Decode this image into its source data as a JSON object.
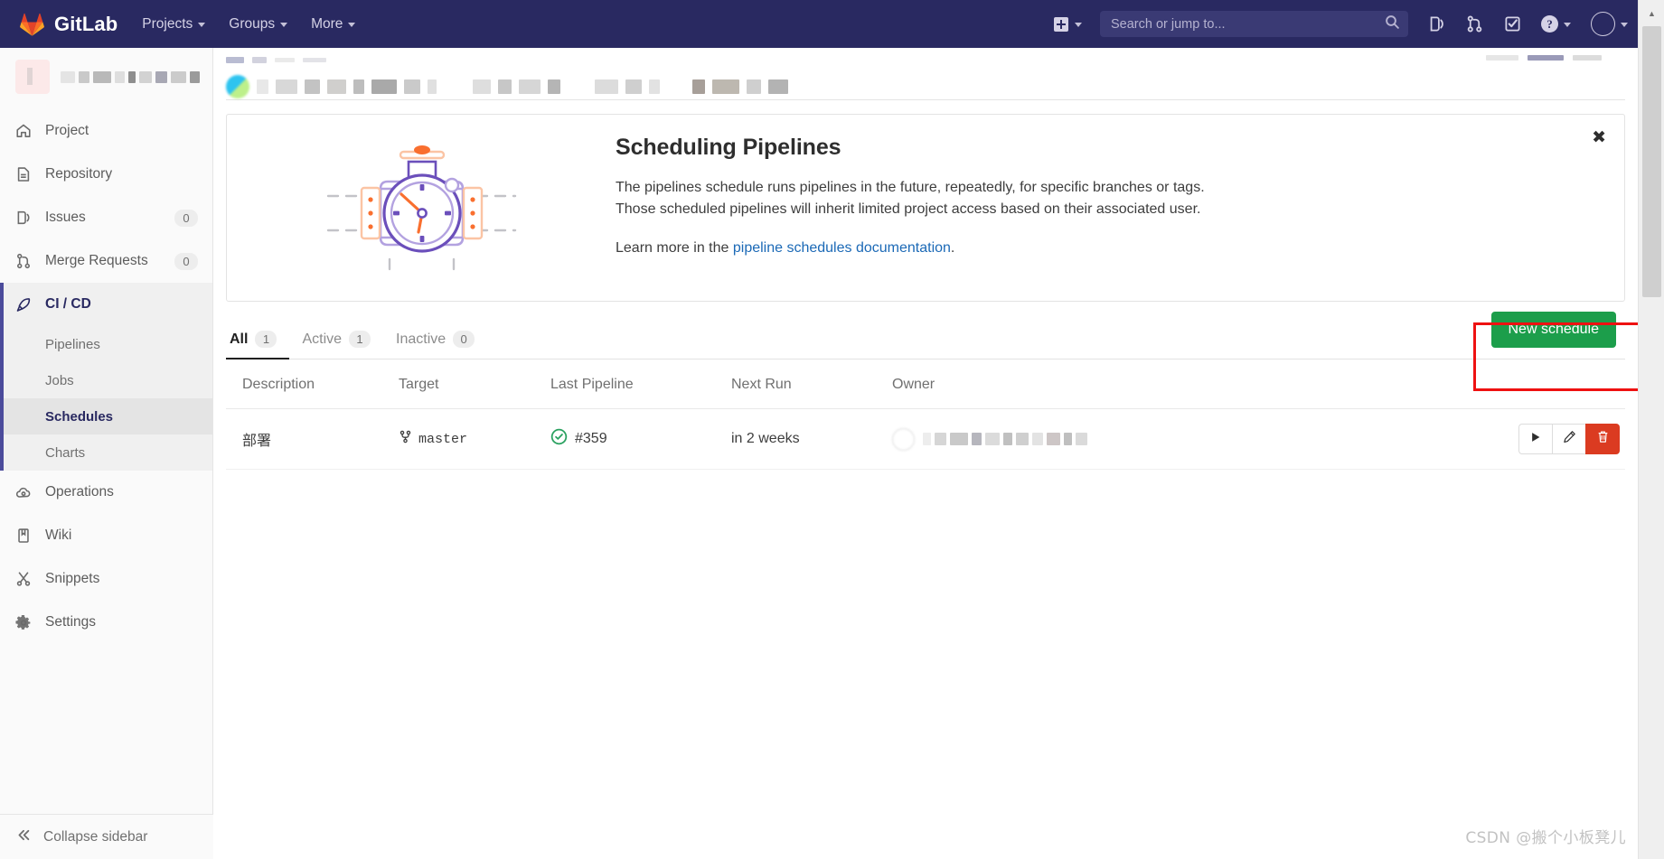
{
  "navbar": {
    "brand": "GitLab",
    "brand_icon": "gitlab-tanuki-logo",
    "items": [
      {
        "label": "Projects",
        "icon": "chevron-down-icon"
      },
      {
        "label": "Groups",
        "icon": "chevron-down-icon"
      },
      {
        "label": "More",
        "icon": "chevron-down-icon"
      }
    ],
    "new_icon": "plus-square-icon",
    "search": {
      "placeholder": "Search or jump to...",
      "value": "",
      "icon": "search-icon"
    },
    "icons": [
      {
        "name": "issues-icon"
      },
      {
        "name": "merge-requests-icon"
      },
      {
        "name": "todos-checkbox-icon"
      }
    ],
    "help": {
      "glyph": "?",
      "icon": "help-circle-icon"
    },
    "user": {
      "icon": "user-avatar-icon"
    }
  },
  "sidebar": {
    "project": {
      "name_redacted": "",
      "avatar_icon": "project-avatar"
    },
    "items": [
      {
        "label": "Project",
        "icon": "home-icon",
        "badge": ""
      },
      {
        "label": "Repository",
        "icon": "document-icon",
        "badge": ""
      },
      {
        "label": "Issues",
        "icon": "issues-icon",
        "badge": "0"
      },
      {
        "label": "Merge Requests",
        "icon": "merge-requests-icon",
        "badge": "0"
      }
    ],
    "cicd": {
      "label": "CI / CD",
      "icon": "rocket-icon",
      "sub_items": [
        {
          "label": "Pipelines",
          "active": false
        },
        {
          "label": "Jobs",
          "active": false
        },
        {
          "label": "Schedules",
          "active": true
        },
        {
          "label": "Charts",
          "active": false
        }
      ]
    },
    "items_after": [
      {
        "label": "Operations",
        "icon": "cloud-gear-icon",
        "badge": ""
      },
      {
        "label": "Wiki",
        "icon": "book-icon",
        "badge": ""
      },
      {
        "label": "Snippets",
        "icon": "scissors-icon",
        "badge": ""
      },
      {
        "label": "Settings",
        "icon": "gear-icon",
        "badge": ""
      }
    ],
    "collapse": {
      "label": "Collapse sidebar",
      "icon": "chevron-double-left-icon"
    }
  },
  "banner": {
    "title": "Scheduling Pipelines",
    "paragraph_line1": "The pipelines schedule runs pipelines in the future, repeatedly, for specific branches or tags.",
    "paragraph_line2": "Those scheduled pipelines will inherit limited project access based on their associated user.",
    "learn_prefix": "Learn more in the ",
    "learn_link": "pipeline schedules documentation",
    "learn_suffix": ".",
    "close_icon": "close-icon",
    "illustration": "pipeline-stopwatch-valve-illustration"
  },
  "tabs": [
    {
      "label": "All",
      "count": "1",
      "active": true
    },
    {
      "label": "Active",
      "count": "1",
      "active": false
    },
    {
      "label": "Inactive",
      "count": "0",
      "active": false
    }
  ],
  "new_schedule_button": {
    "label": "New schedule",
    "color": "#1c9e4b",
    "highlighted": true
  },
  "highlight_color": "#ee1111",
  "table": {
    "headers": [
      "Description",
      "Target",
      "Last Pipeline",
      "Next Run",
      "Owner",
      ""
    ],
    "rows": [
      {
        "description": "部署",
        "target": "master",
        "target_icon": "branch-icon",
        "last_pipeline": "#359",
        "last_pipeline_status": "passed",
        "status_icon": "status-success-icon",
        "next_run": "in 2 weeks",
        "owner_redacted": "",
        "actions": [
          {
            "name": "play-button",
            "icon": "play-icon"
          },
          {
            "name": "edit-button",
            "icon": "pencil-icon"
          },
          {
            "name": "delete-button",
            "icon": "trash-icon"
          }
        ]
      }
    ]
  },
  "watermark": "CSDN @搬个小板凳儿"
}
